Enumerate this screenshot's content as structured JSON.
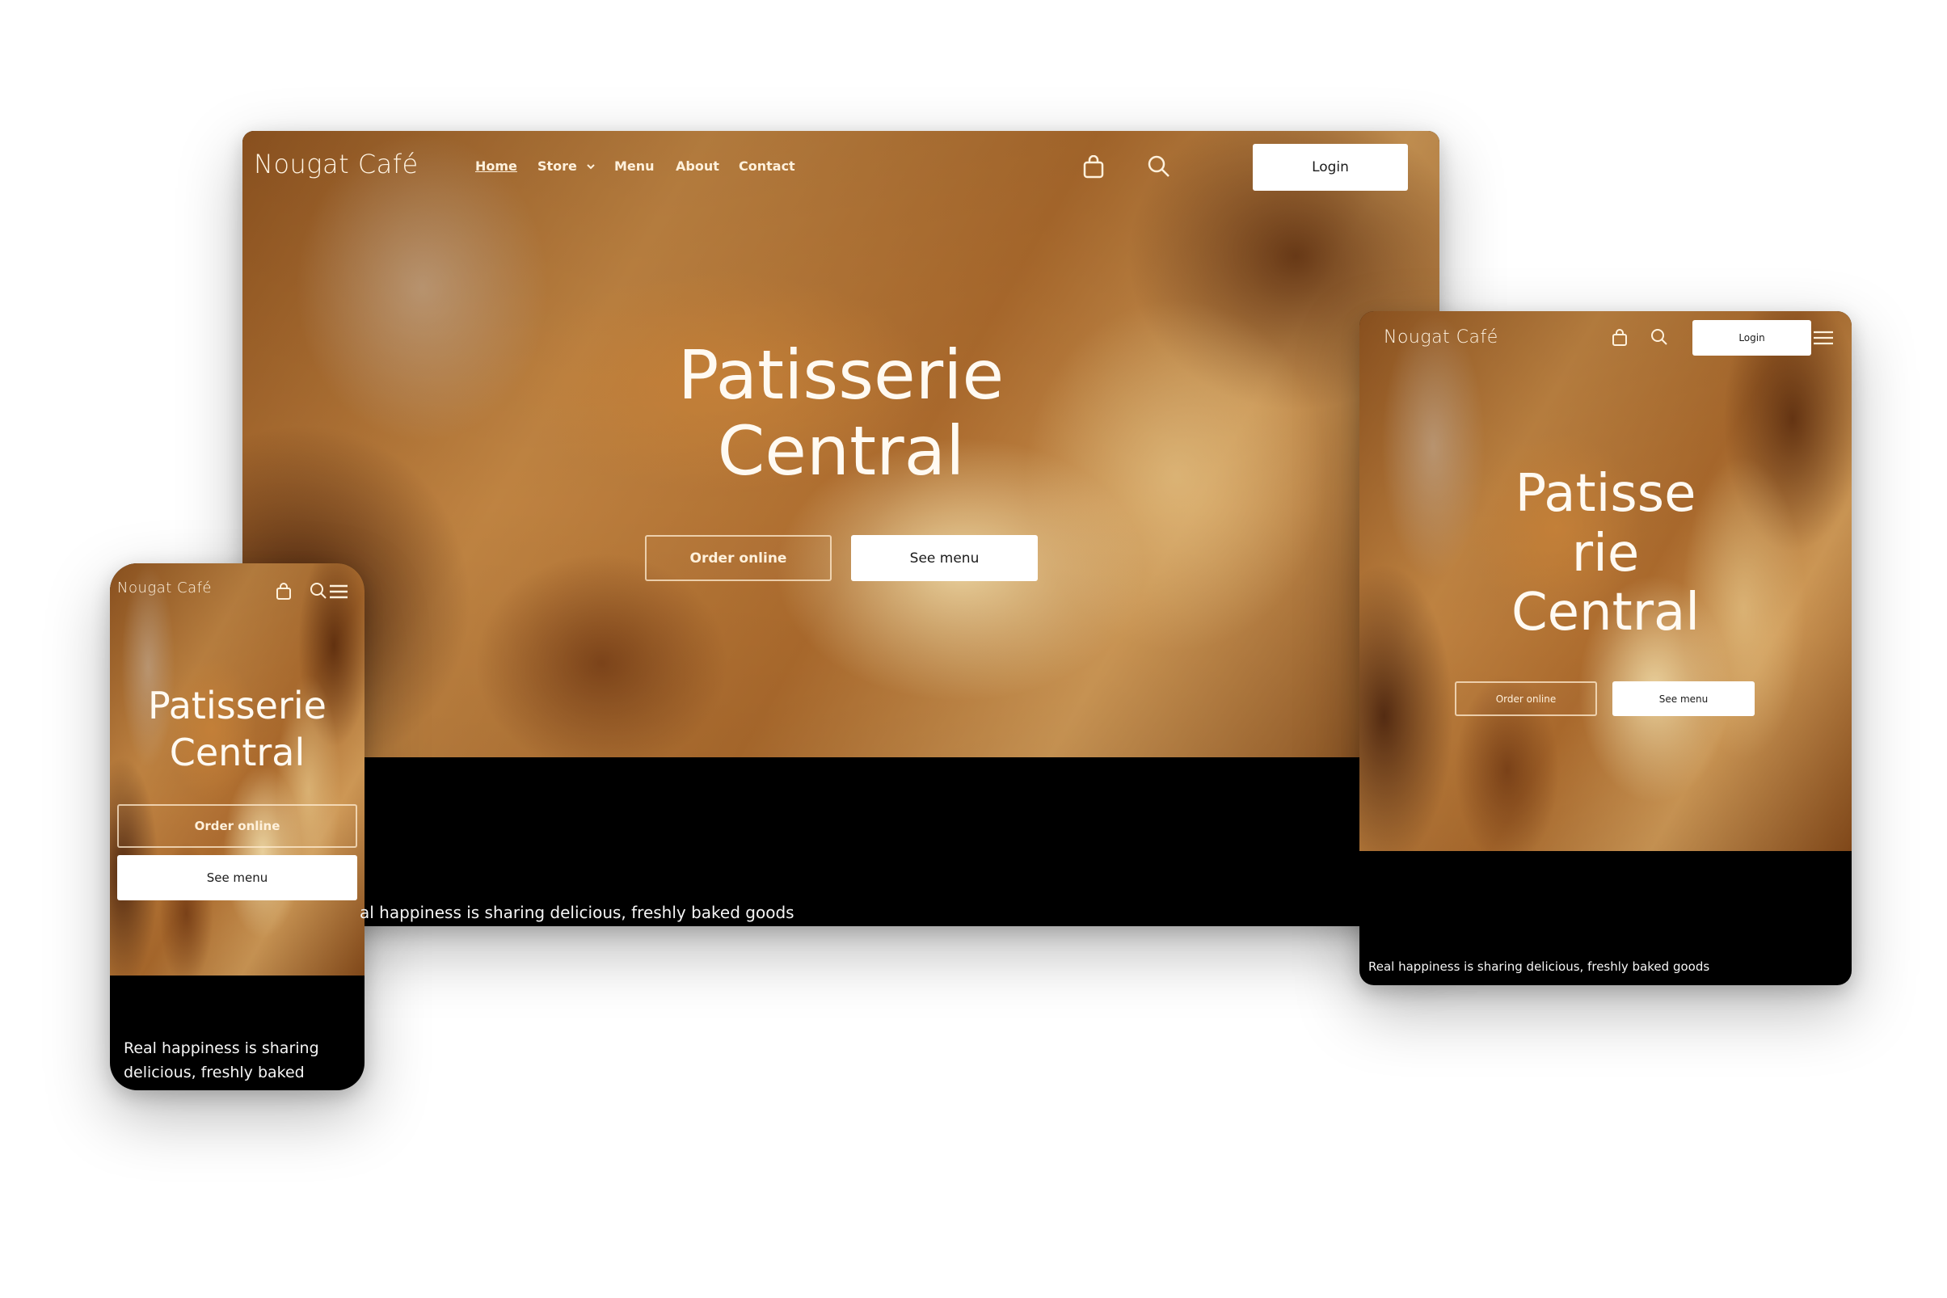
{
  "brand": {
    "name": "Nougat Café"
  },
  "colors": {
    "text_cream": "#fff4e3",
    "button_solid_bg": "#ffffff",
    "button_solid_text": "#1b1b1b",
    "footer_bg": "#000000",
    "hero_brown": "#b5702f"
  },
  "desktop": {
    "nav": {
      "items": [
        {
          "label": "Home",
          "active": true
        },
        {
          "label": "Store",
          "has_dropdown": true
        },
        {
          "label": "Menu"
        },
        {
          "label": "About"
        },
        {
          "label": "Contact"
        }
      ]
    },
    "icons": [
      "shopping-bag-icon",
      "search-icon"
    ],
    "login_label": "Login",
    "hero": {
      "title_line1": "Patisserie",
      "title_line2": "Central",
      "order_label": "Order online",
      "menu_label": "See menu"
    },
    "tagline": "al happiness is sharing delicious, freshly baked goods"
  },
  "tablet": {
    "icons": [
      "shopping-bag-icon",
      "search-icon",
      "hamburger-menu-icon"
    ],
    "login_label": "Login",
    "hero": {
      "title_line1": "Patisse",
      "title_line2": "rie",
      "title_line3": "Central",
      "order_label": "Order online",
      "menu_label": "See menu"
    },
    "tagline": "Real happiness is sharing delicious, freshly baked goods"
  },
  "mobile": {
    "icons": [
      "shopping-bag-icon",
      "search-icon",
      "hamburger-menu-icon"
    ],
    "hero": {
      "title_line1": "Patisserie",
      "title_line2": "Central",
      "order_label": "Order online",
      "menu_label": "See menu"
    },
    "tagline_line1": "Real happiness is sharing",
    "tagline_line2": "delicious, freshly baked"
  }
}
